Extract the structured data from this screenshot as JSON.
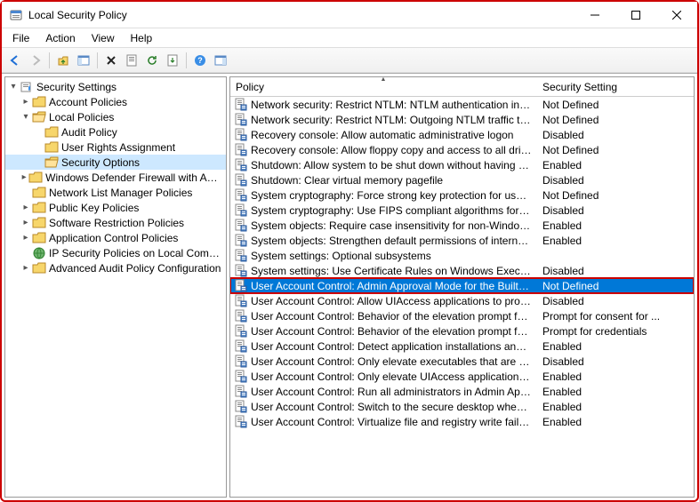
{
  "window": {
    "title": "Local Security Policy"
  },
  "menu": {
    "file": "File",
    "action": "Action",
    "view": "View",
    "help": "Help"
  },
  "tree": {
    "root": "Security Settings",
    "account_policies": "Account Policies",
    "local_policies": "Local Policies",
    "audit_policy": "Audit Policy",
    "user_rights": "User Rights Assignment",
    "security_options": "Security Options",
    "defender": "Windows Defender Firewall with Advanced Security",
    "network_list": "Network List Manager Policies",
    "public_key": "Public Key Policies",
    "software_restrict": "Software Restriction Policies",
    "app_control": "Application Control Policies",
    "ip_security": "IP Security Policies on Local Computer",
    "advanced_audit": "Advanced Audit Policy Configuration"
  },
  "columns": {
    "policy": "Policy",
    "setting": "Security Setting"
  },
  "policies": [
    {
      "name": "Network security: Restrict NTLM: NTLM authentication in thi...",
      "setting": "Not Defined"
    },
    {
      "name": "Network security: Restrict NTLM: Outgoing NTLM traffic to r...",
      "setting": "Not Defined"
    },
    {
      "name": "Recovery console: Allow automatic administrative logon",
      "setting": "Disabled"
    },
    {
      "name": "Recovery console: Allow floppy copy and access to all drives...",
      "setting": "Not Defined"
    },
    {
      "name": "Shutdown: Allow system to be shut down without having to...",
      "setting": "Enabled"
    },
    {
      "name": "Shutdown: Clear virtual memory pagefile",
      "setting": "Disabled"
    },
    {
      "name": "System cryptography: Force strong key protection for user k...",
      "setting": "Not Defined"
    },
    {
      "name": "System cryptography: Use FIPS compliant algorithms for en...",
      "setting": "Disabled"
    },
    {
      "name": "System objects: Require case insensitivity for non-Windows ...",
      "setting": "Enabled"
    },
    {
      "name": "System objects: Strengthen default permissions of internal s...",
      "setting": "Enabled"
    },
    {
      "name": "System settings: Optional subsystems",
      "setting": ""
    },
    {
      "name": "System settings: Use Certificate Rules on Windows Executab...",
      "setting": "Disabled"
    },
    {
      "name": "User Account Control: Admin Approval Mode for the Built-i...",
      "setting": "Not Defined",
      "selected": true
    },
    {
      "name": "User Account Control: Allow UIAccess applications to prom...",
      "setting": "Disabled"
    },
    {
      "name": "User Account Control: Behavior of the elevation prompt for ...",
      "setting": "Prompt for consent for ..."
    },
    {
      "name": "User Account Control: Behavior of the elevation prompt for ...",
      "setting": "Prompt for credentials"
    },
    {
      "name": "User Account Control: Detect application installations and p...",
      "setting": "Enabled"
    },
    {
      "name": "User Account Control: Only elevate executables that are sig...",
      "setting": "Disabled"
    },
    {
      "name": "User Account Control: Only elevate UIAccess applications th...",
      "setting": "Enabled"
    },
    {
      "name": "User Account Control: Run all administrators in Admin Appr...",
      "setting": "Enabled"
    },
    {
      "name": "User Account Control: Switch to the secure desktop when pr...",
      "setting": "Enabled"
    },
    {
      "name": "User Account Control: Virtualize file and registry write failure...",
      "setting": "Enabled"
    }
  ],
  "layout": {
    "policy_col_width": 345,
    "setting_col_width": 155
  }
}
